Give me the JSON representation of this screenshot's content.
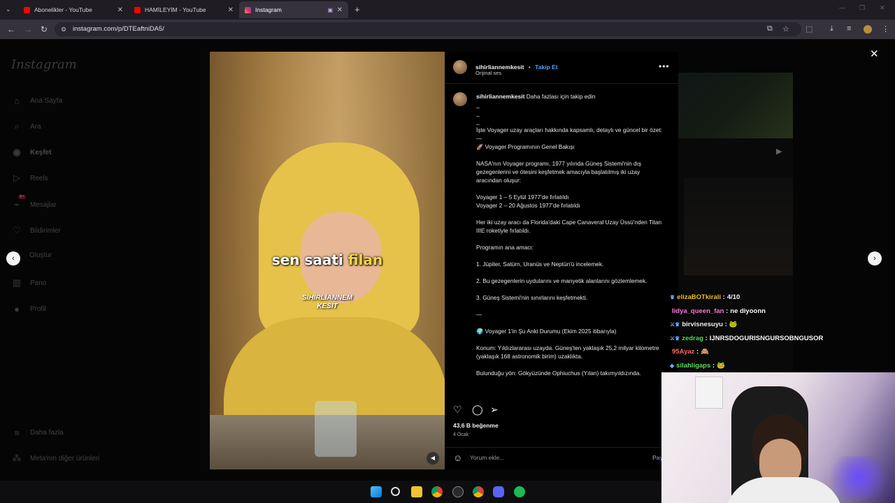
{
  "browser": {
    "tabs": [
      {
        "title": "Abonelikler - YouTube",
        "active": false,
        "favicon": "youtube-icon",
        "color": "#ff0000"
      },
      {
        "title": "HAMİLEYİM - YouTube",
        "active": false,
        "favicon": "youtube-icon",
        "color": "#ff0000"
      },
      {
        "title": "Instagram",
        "active": true,
        "favicon": "instagram-icon",
        "color": "#e1306c"
      }
    ],
    "url": "instagram.com/p/DTEaftniDA5/"
  },
  "sidebar": {
    "logo": "Instagram",
    "items": [
      {
        "label": "Ana Sayfa",
        "icon": "home-icon"
      },
      {
        "label": "Ara",
        "icon": "search-icon"
      },
      {
        "label": "Keşfet",
        "icon": "compass-icon",
        "active": true
      },
      {
        "label": "Reels",
        "icon": "reels-icon"
      },
      {
        "label": "Mesajlar",
        "icon": "messenger-icon",
        "badge": "9+"
      },
      {
        "label": "Bildirimler",
        "icon": "heart-icon"
      },
      {
        "label": "Oluştur",
        "icon": "plus-icon"
      },
      {
        "label": "Pano",
        "icon": "dashboard-icon"
      },
      {
        "label": "Profil",
        "icon": "profile-icon"
      }
    ],
    "bottom": [
      {
        "label": "Daha fazla",
        "icon": "menu-icon"
      },
      {
        "label": "Meta'nın diğer ürünleri",
        "icon": "grid-icon"
      }
    ]
  },
  "video": {
    "caption_pre": "sen saati ",
    "caption_hl": "filan",
    "watermark_1": "SİHİRLİANNEM",
    "watermark_2": "KESİT"
  },
  "post": {
    "username": "sihirliannemkesit",
    "dot": "•",
    "follow": "Takip Et",
    "audio": "Orijinal ses",
    "caption_first": "Daha fazlası için takip edin",
    "lines": [
      "_",
      "_",
      "_",
      "İşte Voyager uzay araçları hakkında kapsamlı, detaylı ve güncel bir özet:",
      "—",
      "🚀 Voyager Programının Genel Bakışı",
      "",
      "NASA'nın Voyager programı, 1977 yılında Güneş Sistemi'nin dış gezegenlerini ve ötesini keşfetmek amacıyla başlatılmış iki uzay aracından oluşur:",
      "",
      "Voyager 1 – 5 Eylül 1977'de fırlatıldı",
      "Voyager 2 – 20 Ağustos 1977'de fırlatıldı",
      "",
      "Her iki uzay aracı da Florida'daki Cape Canaveral Uzay Üssü'nden Titan IIIE roketiyle fırlatıldı.",
      "",
      "Programın ana amacı:",
      "",
      "1. Jüpiter, Satürn, Uranüs ve Neptün'ü incelemek.",
      "",
      "2. Bu gezegenlerin uydularını ve manyetik alanlarını gözlemlemek.",
      "",
      "3. Güneş Sistemi'nin sınırlarını keşfetmekti.",
      "",
      "—",
      "",
      "🌍 Voyager 1'in Şu Anki Durumu (Ekim 2025 itibarıyla)",
      "",
      "Konum: Yıldızlararası uzayda. Güneş'ten yaklaşık 25,2 milyar kilometre (yaklaşık 168 astronomik birim) uzaklıkta.",
      "",
      "Bulunduğu yön: Gökyüzünde Ophiuchus (Yılan) takımyıldızında."
    ],
    "likes": "43,6 B beğenme",
    "date": "4 Ocak",
    "comment_placeholder": "Yorum ekle...",
    "post_label": "Pay"
  },
  "chat": [
    {
      "prefix": "♛",
      "user": "elizaBOTkirali",
      "color": "#f0c419",
      "msg": "4/10"
    },
    {
      "prefix": "",
      "user": "lidya_queen_fan",
      "color": "#ff7ad9",
      "msg": "ne diyoonn"
    },
    {
      "prefix": "⚔♛",
      "user": "birvisnesuyu",
      "color": "#f5f5f5",
      "msg": "🐸"
    },
    {
      "prefix": "⚔♛",
      "user": "zedrag",
      "color": "#59d659",
      "msg": "IJNRSDOGURISNGURSOBNGUSOR"
    },
    {
      "prefix": "",
      "user": "95Ayaz",
      "color": "#ff6a6a",
      "msg": "🙈"
    },
    {
      "prefix": "◆",
      "user": "silahligaps",
      "color": "#5fe05f",
      "msg": "🐸"
    }
  ]
}
